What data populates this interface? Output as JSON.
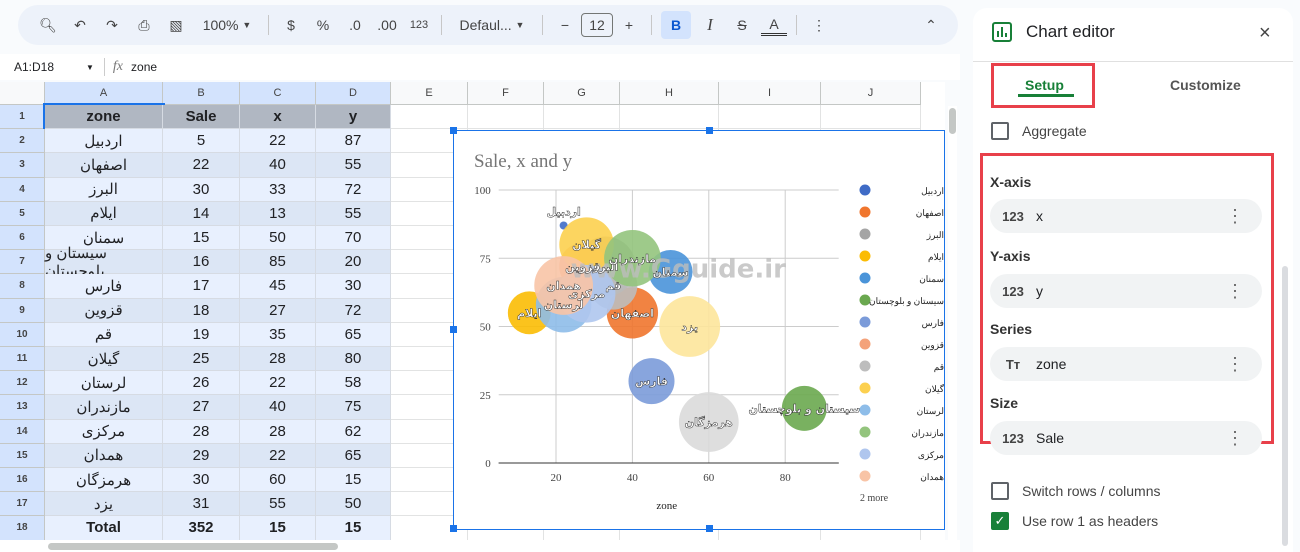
{
  "toolbar": {
    "zoom": "100%",
    "currency": "$",
    "percent": "%",
    "dec_decrease": ".0",
    "dec_increase": ".00",
    "number_format": "123",
    "font": "Defaul...",
    "font_size": "12",
    "bold": "B",
    "italic": "I",
    "strike": "S",
    "text_color": "A"
  },
  "formula_bar": {
    "range": "A1:D18",
    "fx": "fx",
    "value": "zone"
  },
  "columns": [
    "A",
    "B",
    "C",
    "D",
    "E",
    "F",
    "G",
    "H",
    "I",
    "J"
  ],
  "headers": [
    "zone",
    "Sale",
    "x",
    "y"
  ],
  "rows": [
    [
      "اردبیل",
      5,
      22,
      87
    ],
    [
      "اصفهان",
      22,
      40,
      55
    ],
    [
      "البرز",
      30,
      33,
      72
    ],
    [
      "ایلام",
      14,
      13,
      55
    ],
    [
      "سمنان",
      15,
      50,
      70
    ],
    [
      "سیستان و بلوچستان",
      16,
      85,
      20
    ],
    [
      "فارس",
      17,
      45,
      30
    ],
    [
      "قزوین",
      18,
      27,
      72
    ],
    [
      "قم",
      19,
      35,
      65
    ],
    [
      "گیلان",
      25,
      28,
      80
    ],
    [
      "لرستان",
      26,
      22,
      58
    ],
    [
      "مازندران",
      27,
      40,
      75
    ],
    [
      "مرکزی",
      28,
      28,
      62
    ],
    [
      "همدان",
      29,
      22,
      65
    ],
    [
      "هرمزگان",
      30,
      60,
      15
    ],
    [
      "یزد",
      31,
      55,
      50
    ],
    [
      "Total",
      352,
      15,
      15
    ]
  ],
  "chart_data": {
    "type": "bubble",
    "title": "Sale, x and y",
    "xlabel": "zone",
    "ylabel": "",
    "xlim": [
      5,
      94
    ],
    "ylim": [
      0,
      100
    ],
    "xticks": [
      "20",
      "40",
      "60",
      "80"
    ],
    "yticks": [
      "0",
      "25",
      "50",
      "75",
      "100"
    ],
    "grid": true,
    "legend_position": "right",
    "legend_more": "2 more",
    "watermark": "www.Gguide.ir",
    "points": [
      {
        "name": "اردبیل",
        "x": 22,
        "y": 87,
        "size": 5,
        "color": "#3f6bc6"
      },
      {
        "name": "اصفهان",
        "x": 40,
        "y": 55,
        "size": 22,
        "color": "#f0762e"
      },
      {
        "name": "البرز",
        "x": 33,
        "y": 72,
        "size": 30,
        "color": "#a5a5a5"
      },
      {
        "name": "ایلام",
        "x": 13,
        "y": 55,
        "size": 14,
        "color": "#fbbc04"
      },
      {
        "name": "سمنان",
        "x": 50,
        "y": 70,
        "size": 15,
        "color": "#4a94d9"
      },
      {
        "name": "سیستان و بلوچستان",
        "x": 85,
        "y": 20,
        "size": 16,
        "color": "#6aa84f"
      },
      {
        "name": "فارس",
        "x": 45,
        "y": 30,
        "size": 17,
        "color": "#7b9bd9"
      },
      {
        "name": "قزوین",
        "x": 27,
        "y": 72,
        "size": 18,
        "color": "#f4a27a"
      },
      {
        "name": "قم",
        "x": 35,
        "y": 65,
        "size": 19,
        "color": "#bdbdbd"
      },
      {
        "name": "گیلان",
        "x": 28,
        "y": 80,
        "size": 25,
        "color": "#fcd04f"
      },
      {
        "name": "لرستان",
        "x": 22,
        "y": 58,
        "size": 26,
        "color": "#8ebde9"
      },
      {
        "name": "مازندران",
        "x": 40,
        "y": 75,
        "size": 27,
        "color": "#93c47d"
      },
      {
        "name": "مرکزی",
        "x": 28,
        "y": 62,
        "size": 28,
        "color": "#afc6ee"
      },
      {
        "name": "همدان",
        "x": 22,
        "y": 65,
        "size": 29,
        "color": "#f8c4a6"
      },
      {
        "name": "هرمزگان",
        "x": 60,
        "y": 15,
        "size": 30,
        "color": "#dadada"
      },
      {
        "name": "یزد",
        "x": 55,
        "y": 50,
        "size": 31,
        "color": "#fde69b"
      }
    ]
  },
  "editor": {
    "title": "Chart editor",
    "tabs": [
      "Setup",
      "Customize"
    ],
    "aggregate": "Aggregate",
    "xaxis_label": "X-axis",
    "xaxis_value": "x",
    "yaxis_label": "Y-axis",
    "yaxis_value": "y",
    "series_label": "Series",
    "series_value": "zone",
    "size_label": "Size",
    "size_value": "Sale",
    "num_icon": "123",
    "text_icon": "Tт",
    "switch": "Switch rows / columns",
    "use_row1": "Use row 1 as headers",
    "accent": "#188038",
    "highlight": "#e8404a"
  }
}
